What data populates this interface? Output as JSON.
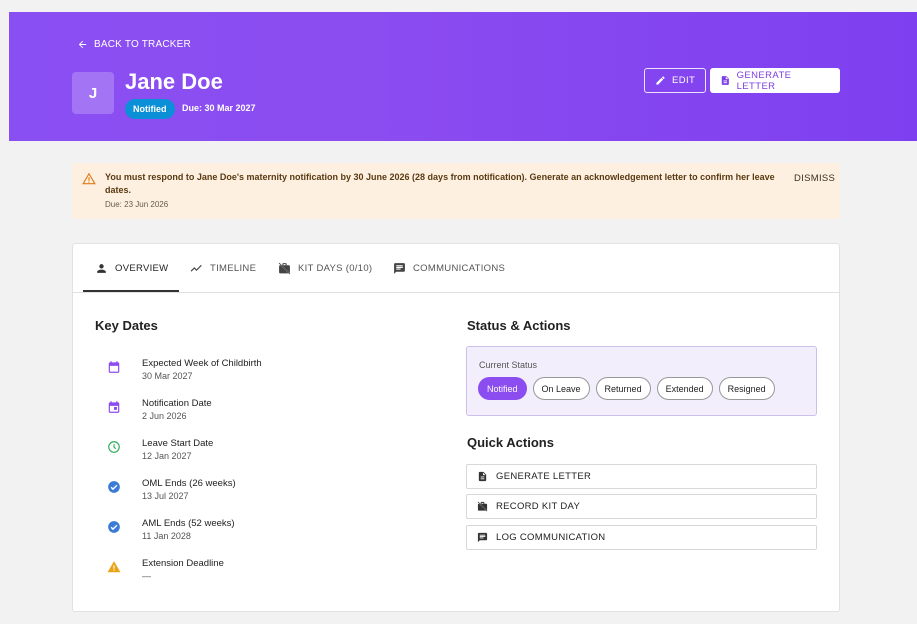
{
  "header": {
    "back_label": "BACK TO TRACKER",
    "avatar_initial": "J",
    "name": "Jane Doe",
    "status_badge": "Notified",
    "due": "Due: 30 Mar 2027",
    "edit_label": "EDIT",
    "generate_letter_label": "GENERATE LETTER"
  },
  "alert": {
    "message": "You must respond to Jane Doe's maternity notification by 30 June 2026 (28 days from notification). Generate an acknowledgement letter to confirm her leave dates.",
    "due": "Due: 23 Jun 2026",
    "dismiss_label": "DISMISS"
  },
  "tabs": [
    {
      "label": "OVERVIEW",
      "icon": "person-icon"
    },
    {
      "label": "TIMELINE",
      "icon": "timeline-icon"
    },
    {
      "label": "KIT DAYS (0/10)",
      "icon": "work-off-icon"
    },
    {
      "label": "COMMUNICATIONS",
      "icon": "chat-icon"
    }
  ],
  "key_dates": {
    "title": "Key Dates",
    "items": [
      {
        "label": "Expected Week of Childbirth",
        "value": "30 Mar 2027",
        "icon": "calendar-icon",
        "color": "#8b4cf0"
      },
      {
        "label": "Notification Date",
        "value": "2 Jun 2026",
        "icon": "event-icon",
        "color": "#8b4cf0"
      },
      {
        "label": "Leave Start Date",
        "value": "12 Jan 2027",
        "icon": "clock-icon",
        "color": "#2fae5a"
      },
      {
        "label": "OML Ends (26 weeks)",
        "value": "13 Jul 2027",
        "icon": "check-circle-icon",
        "color": "#3a7bd5"
      },
      {
        "label": "AML Ends (52 weeks)",
        "value": "11 Jan 2028",
        "icon": "check-circle-icon",
        "color": "#3a7bd5"
      },
      {
        "label": "Extension Deadline",
        "value": "—",
        "icon": "warning-icon",
        "color": "#e8a317"
      }
    ]
  },
  "status_actions": {
    "title": "Status & Actions",
    "current_status_label": "Current Status",
    "statuses": [
      "Notified",
      "On Leave",
      "Returned",
      "Extended",
      "Resigned"
    ],
    "active_status": "Notified"
  },
  "quick_actions": {
    "title": "Quick Actions",
    "items": [
      {
        "label": "GENERATE LETTER",
        "icon": "document-icon"
      },
      {
        "label": "RECORD KIT DAY",
        "icon": "work-off-icon"
      },
      {
        "label": "LOG COMMUNICATION",
        "icon": "chat-icon"
      }
    ]
  },
  "colors": {
    "accent": "#8b4cf0",
    "badge": "#0b8fd6",
    "alert_bg": "#fdf0e1"
  }
}
